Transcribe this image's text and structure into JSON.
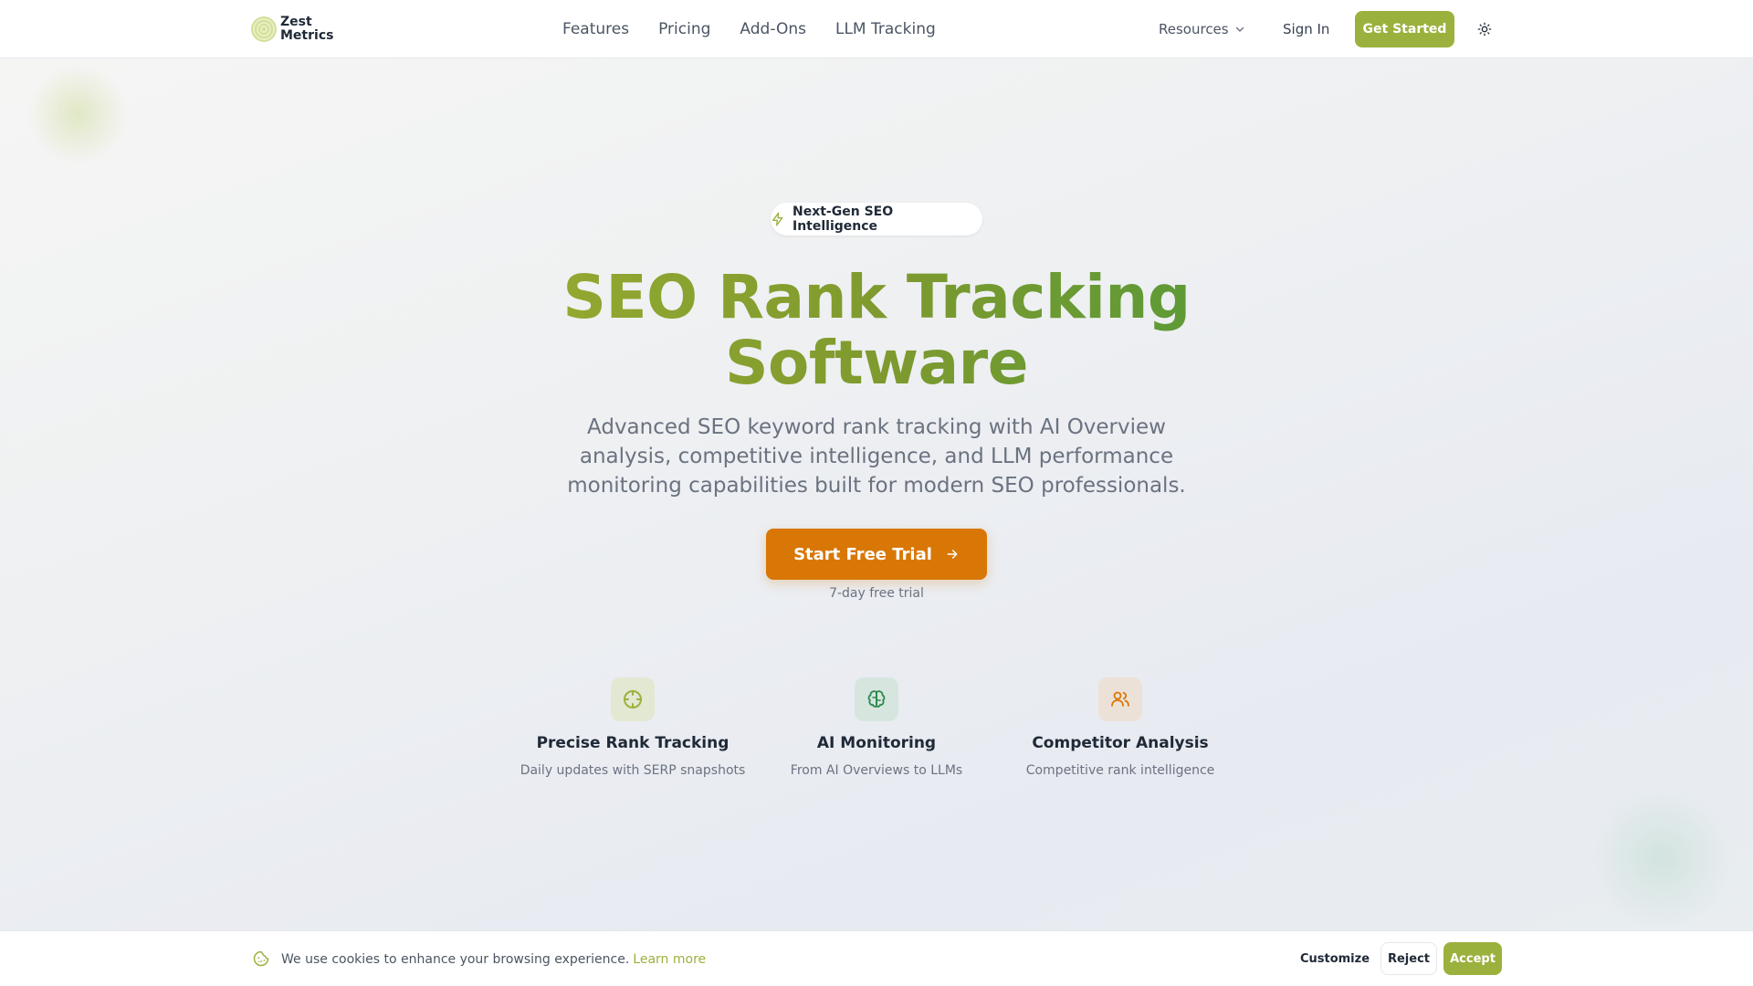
{
  "header": {
    "logo_text": "Zest Metrics",
    "nav": [
      "Features",
      "Pricing",
      "Add-Ons",
      "LLM Tracking"
    ],
    "resources_label": "Resources",
    "sign_in_label": "Sign In",
    "get_started_label": "Get Started"
  },
  "hero": {
    "badge_text": "Next-Gen SEO Intelligence",
    "title_line1": "SEO Rank Tracking",
    "title_line2": "Software",
    "subtitle": "Advanced SEO keyword rank tracking with AI Overview analysis, competitive intelligence, and LLM performance monitoring capabilities built for modern SEO professionals.",
    "cta_label": "Start Free Trial",
    "trial_note": "7-day free trial"
  },
  "features": [
    {
      "title": "Precise Rank Tracking",
      "description": "Daily updates with SERP snapshots",
      "icon": "crosshair-icon"
    },
    {
      "title": "AI Monitoring",
      "description": "From AI Overviews to LLMs",
      "icon": "brain-icon"
    },
    {
      "title": "Competitor Analysis",
      "description": "Competitive rank intelligence",
      "icon": "users-icon"
    }
  ],
  "cookie": {
    "message": "We use cookies to enhance your browsing experience.",
    "learn_more": "Learn more",
    "customize_label": "Customize",
    "reject_label": "Reject",
    "accept_label": "Accept"
  },
  "colors": {
    "brand_green": "#9bb13d",
    "cta_orange": "#d97706"
  }
}
